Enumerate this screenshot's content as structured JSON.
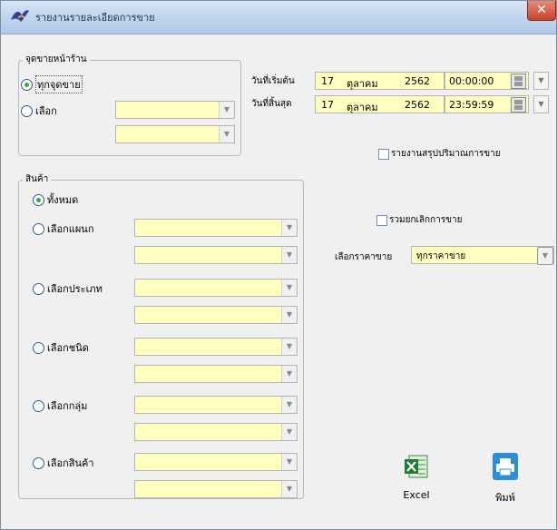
{
  "window": {
    "title": "รายงานรายละเอียดการขาย",
    "close_glyph": "✕"
  },
  "store_group": {
    "legend": "จุดขายหน้าร้าน",
    "all_label": "ทุกจุดขาย",
    "select_label": "เลือก"
  },
  "dates": {
    "start_label": "วันที่เริ่มต้น",
    "end_label": "วันที่สิ้นสุด",
    "start": {
      "day": "17",
      "month": "ตุลาคม",
      "year": "2562",
      "time": "00:00:00"
    },
    "end": {
      "day": "17",
      "month": "ตุลาคม",
      "year": "2562",
      "time": "23:59:59"
    }
  },
  "options": {
    "summary_qty_label": "รายงานสรุปปริมาณการขาย",
    "include_cancel_label": "รวมยกเลิกการขาย",
    "price_label": "เลือกราคาขาย",
    "price_value": "ทุกราคาขาย"
  },
  "product_group": {
    "legend": "สินค้า",
    "all_label": "ทั้งหมด",
    "department_label": "เลือกแผนก",
    "type_label": "เลือกประเภท",
    "kind_label": "เลือกชนิด",
    "group_label": "เลือกกลุ่ม",
    "product_label": "เลือกสินค้า"
  },
  "actions": {
    "excel_label": "Excel",
    "print_label": "พิมพ์"
  },
  "colors": {
    "field_bg": "#ffffc0",
    "radio_on": "#2fa84a",
    "titlebar": "#c2d6ee",
    "close": "#c9442c"
  }
}
